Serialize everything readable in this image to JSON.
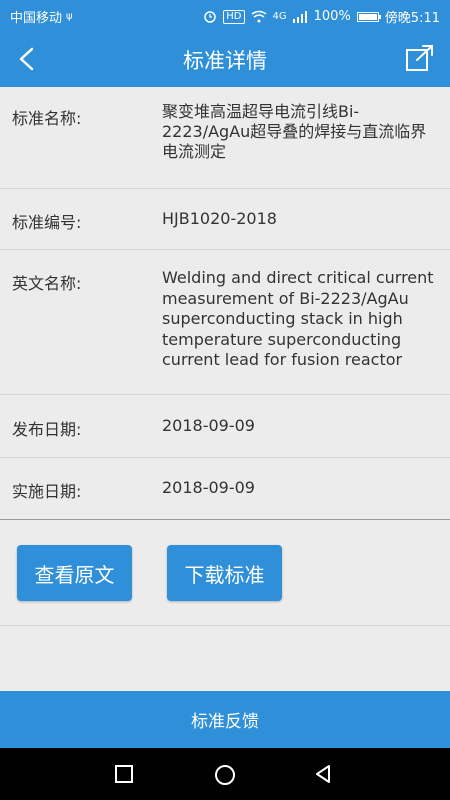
{
  "status_bar": {
    "carrier": "中国移动",
    "usb_symbol": "ψ",
    "hd": "HD",
    "network": "4G",
    "battery": "100%",
    "time": "傍晚5:11"
  },
  "header": {
    "title": "标准详情"
  },
  "details": [
    {
      "label": "标准名称:",
      "value": "聚变堆高温超导电流引线Bi-2223/AgAu超导叠的焊接与直流临界电流测定"
    },
    {
      "label": "标准编号:",
      "value": "HJB1020-2018"
    },
    {
      "label": "英文名称:",
      "value": "Welding and direct critical current measurement of Bi-2223/AgAu superconducting stack  in high temperature superconducting current lead for fusion reactor"
    },
    {
      "label": "发布日期:",
      "value": "2018-09-09"
    },
    {
      "label": "实施日期:",
      "value": "2018-09-09"
    }
  ],
  "actions": {
    "view_label": "查看原文",
    "download_label": "下载标准"
  },
  "footer": {
    "feedback_label": "标准反馈"
  }
}
